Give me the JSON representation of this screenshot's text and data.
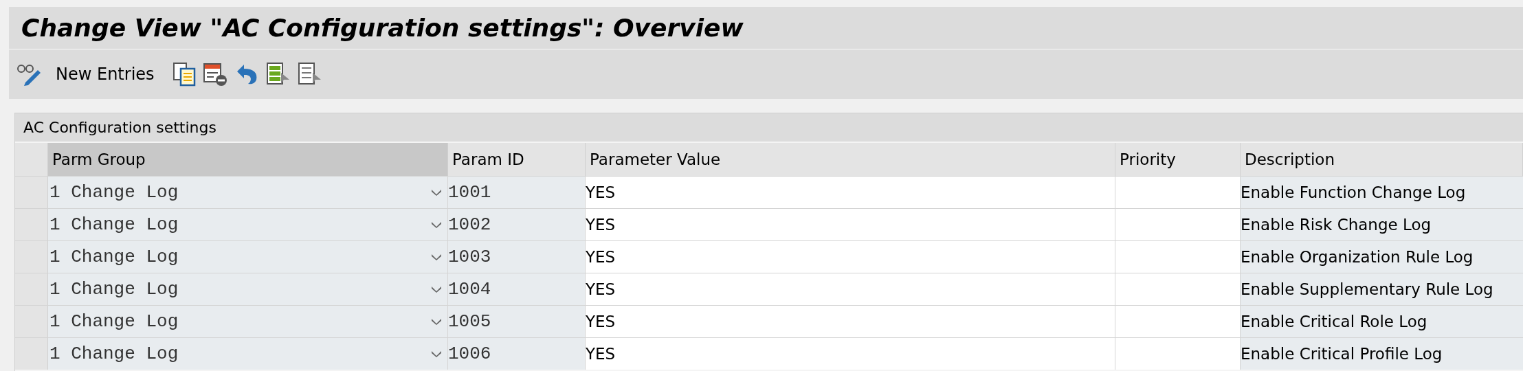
{
  "window": {
    "title": "Change View \"AC Configuration settings\": Overview"
  },
  "toolbar": {
    "new_entries": "New Entries"
  },
  "table": {
    "title": "AC Configuration settings",
    "columns": [
      "Parm Group",
      "Param ID",
      "Parameter Value",
      "Priority",
      "Description"
    ],
    "rows": [
      {
        "parm_group": "1 Change Log",
        "param_id": "1001",
        "parameter_value": "YES",
        "description": "Enable Function Change Log"
      },
      {
        "parm_group": "1 Change Log",
        "param_id": "1002",
        "parameter_value": "YES",
        "description": "Enable Risk Change Log"
      },
      {
        "parm_group": "1 Change Log",
        "param_id": "1003",
        "parameter_value": "YES",
        "description": "Enable Organization Rule Log"
      },
      {
        "parm_group": "1 Change Log",
        "param_id": "1004",
        "parameter_value": "YES",
        "description": "Enable Supplementary Rule Log"
      },
      {
        "parm_group": "1 Change Log",
        "param_id": "1005",
        "parameter_value": "YES",
        "description": "Enable Critical Role Log"
      },
      {
        "parm_group": "1 Change Log",
        "param_id": "1006",
        "parameter_value": "YES",
        "description": "Enable Critical Profile Log"
      }
    ]
  }
}
